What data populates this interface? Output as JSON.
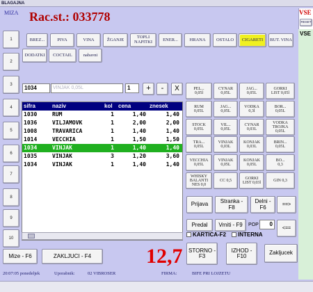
{
  "window": {
    "title": "BLAGAJNA"
  },
  "header": {
    "miza_label": "MIZA",
    "rac_title": "Rac.st.: 033778"
  },
  "vse": {
    "label": "VSE",
    "reset": "RESET",
    "group_label": "VSE"
  },
  "numbers": [
    "1",
    "2",
    "3",
    "4",
    "5",
    "6",
    "7",
    "8",
    "9",
    "10"
  ],
  "categories": [
    "BREZ...",
    "PIVA",
    "VINA",
    "ŽGANJE",
    "TOPLI NAPITKI",
    "ENER...",
    "HRANA",
    "OSTALO",
    "CIGARETI",
    "BUT. VINA",
    "DODATKI",
    "COCTAIL",
    "nabavni"
  ],
  "entry": {
    "code": "1034",
    "name": "VINJAK 0,05L",
    "qty": "1",
    "plus": "+",
    "minus": "-",
    "clear": "X"
  },
  "grid": {
    "headers": [
      "sifra",
      "naziv",
      "kol",
      "cena",
      "znesek"
    ],
    "rows": [
      {
        "sifra": "1030",
        "naziv": "RUM",
        "kol": "1",
        "cena": "1,40",
        "znesek": "1,40"
      },
      {
        "sifra": "1036",
        "naziv": "VILJAMOVK",
        "kol": "1",
        "cena": "2,00",
        "znesek": "2,00"
      },
      {
        "sifra": "1008",
        "naziv": "TRAVARICA",
        "kol": "1",
        "cena": "1,40",
        "znesek": "1,40"
      },
      {
        "sifra": "1014",
        "naziv": "VECCHIA",
        "kol": "1",
        "cena": "1,50",
        "znesek": "1,50"
      },
      {
        "sifra": "1034",
        "naziv": "VINJAK",
        "kol": "1",
        "cena": "1,40",
        "znesek": "1,40"
      },
      {
        "sifra": "1035",
        "naziv": "VINJAK",
        "kol": "3",
        "cena": "1,20",
        "znesek": "3,60"
      },
      {
        "sifra": "1034",
        "naziv": "VINJAK",
        "kol": "1",
        "cena": "1,40",
        "znesek": "1,40"
      }
    ],
    "selected_index": 4
  },
  "products": [
    "PEL...\n0,05l",
    "CYNAR\n0,05L",
    "JAG...\n0,05L",
    "GORKI\nLIST 0,05l",
    "RUM\n0,05L",
    "JAG...\n0,05L",
    "VODKA\n0,3l",
    "BOR...\n0,05L",
    "STOCK\n0,05L",
    "VIL...\n0,05L",
    "CYNAR\n0,03L",
    "VODKA\nTROJKA\n0,05L",
    "TRA...\n0,05L",
    "VINJAK\n0,03L",
    "KONJAK\n0,03L",
    "BRIN...\n0,05L",
    "VECCHIA\n0,05L",
    "VINJAK\n0,05L",
    "KONJAK\n0,05L",
    "BO...\n0,3",
    "WHISKY\nBALANTI\nNES 0,0",
    "CC 0,5",
    "GORKI\nLIST 0,03l",
    "GIN 0,3"
  ],
  "actions": {
    "prijava": "Prijava",
    "stranka": "Stranka -\nF8",
    "delni": "Delni -\nF6",
    "next": "==>",
    "predal": "Predal",
    "vrniti": "Vrniti - F9",
    "pop_label": "POP",
    "pop_value": "0",
    "prev": "<==",
    "kartica": "KARTICA-F2",
    "interna": "INTERNA",
    "mize": "Mize - F6",
    "zakljuci": "ZAKLJUCI - F4",
    "storno": "STORNO -\nF3",
    "izhod": "IZHOD -\nF10",
    "zakljucek": "Zakljucek"
  },
  "total": "12,7",
  "status": {
    "datetime": "20:07:05 ponedeljek",
    "user_label": "Uporabnik:",
    "user_value": "02 VIBROSER",
    "firma_label": "FIRMA:",
    "firma_value": "BIFE PRI LOJZETU"
  },
  "colors": {
    "selected_category": "#f0f020",
    "selected_row": "#20b020",
    "grid_header": "#000080",
    "total": "#e00000",
    "title": "#b00000"
  }
}
